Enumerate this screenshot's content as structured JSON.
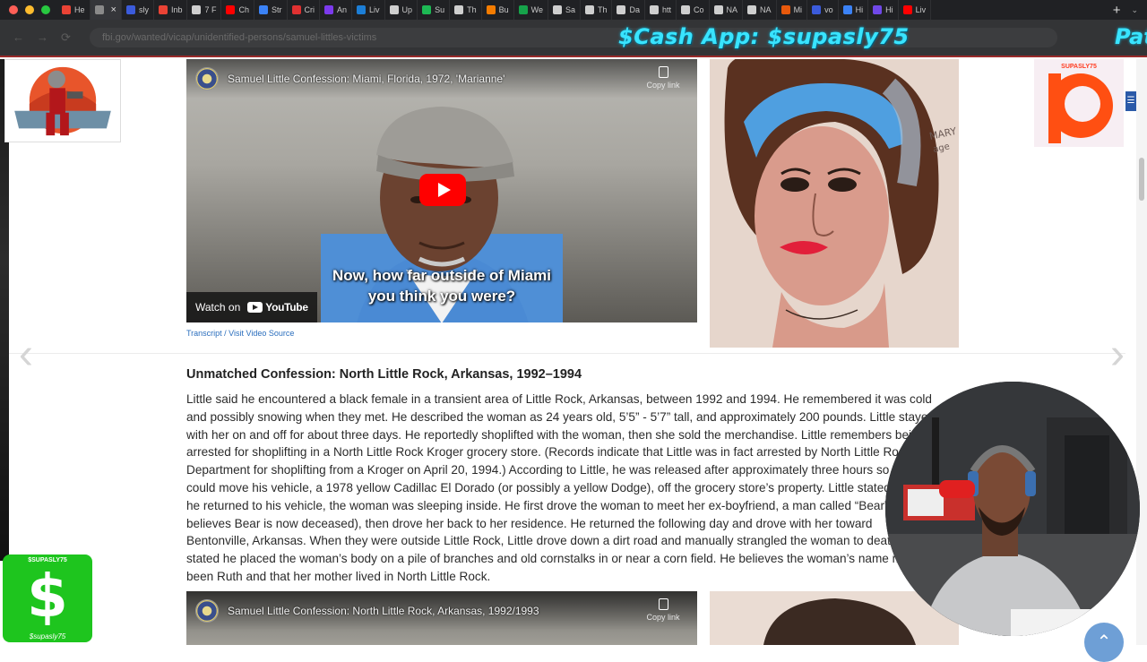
{
  "browser": {
    "tabs": [
      {
        "label": "He",
        "icon": "gmail-icon",
        "color": "#ea4335"
      },
      {
        "label": "",
        "icon": "globe-icon",
        "color": "#8a8a8a",
        "active": true
      },
      {
        "label": "sly",
        "icon": "shield-icon",
        "color": "#3b5bdb"
      },
      {
        "label": "Inb",
        "icon": "gmail-icon",
        "color": "#ea4335"
      },
      {
        "label": "7 F",
        "icon": "glasses-icon",
        "color": "#cfcfcf"
      },
      {
        "label": "Ch",
        "icon": "youtube-icon",
        "color": "#ff0000"
      },
      {
        "label": "Str",
        "icon": "star-icon",
        "color": "#3b82f6"
      },
      {
        "label": "Cri",
        "icon": "record-icon",
        "color": "#e03131"
      },
      {
        "label": "An",
        "icon": "app-icon",
        "color": "#7c3aed"
      },
      {
        "label": "Liv",
        "icon": "k-icon",
        "color": "#1c7ed6"
      },
      {
        "label": "Up",
        "icon": "upload-icon",
        "color": "#cfcfcf"
      },
      {
        "label": "Su",
        "icon": "spotify-icon",
        "color": "#1db954"
      },
      {
        "label": "Th",
        "icon": "doc-icon",
        "color": "#cfcfcf"
      },
      {
        "label": "Bu",
        "icon": "blogger-icon",
        "color": "#f57c00"
      },
      {
        "label": "We",
        "icon": "x-icon",
        "color": "#16a34a"
      },
      {
        "label": "Sa",
        "icon": "apple-icon",
        "color": "#cfcfcf"
      },
      {
        "label": "Th",
        "icon": "square-icon",
        "color": "#cfcfcf"
      },
      {
        "label": "Da",
        "icon": "link-icon",
        "color": "#cfcfcf"
      },
      {
        "label": "htt",
        "icon": "mask-icon",
        "color": "#cfcfcf"
      },
      {
        "label": "Co",
        "icon": "c-icon",
        "color": "#cfcfcf"
      },
      {
        "label": "NA",
        "icon": "c-icon",
        "color": "#cfcfcf"
      },
      {
        "label": "NA",
        "icon": "c-icon",
        "color": "#cfcfcf"
      },
      {
        "label": "Mi",
        "icon": "image-icon",
        "color": "#e8590c"
      },
      {
        "label": "vo",
        "icon": "shield-icon",
        "color": "#3b5bdb"
      },
      {
        "label": "Hi",
        "icon": "history-icon",
        "color": "#3b82f6"
      },
      {
        "label": "Hi",
        "icon": "grid-icon",
        "color": "#7048e8"
      },
      {
        "label": "Liv",
        "icon": "youtube-icon",
        "color": "#ff0000"
      }
    ],
    "new_tab": "+",
    "tab_menu": "⌄",
    "url": "fbi.gov/wanted/vicap/unidentified-persons/samuel-littles-victims",
    "nav": {
      "back": "←",
      "forward": "→",
      "reload": "⟳"
    }
  },
  "overlay": {
    "cash_banner": "$Cash App: $supasly75",
    "cash_banner_right": "Pat",
    "patreon_handle": "SUPASLY75",
    "cashapp_handle": "$SUPASLY75",
    "cashapp_symbol": "$",
    "cashapp_signature": "$supasly75",
    "scroll_top": "⌃"
  },
  "page": {
    "arrow_left": "‹",
    "arrow_right": "›",
    "side_tab": "☰",
    "video_top": {
      "title": "Samuel Little Confession: Miami, Florida, 1972, 'Marianne'",
      "copy_label": "Copy link",
      "caption_line1": "Now, how far outside of Miami",
      "caption_line2": "you think you were?",
      "watch_on": "Watch on",
      "youtube": "YouTube"
    },
    "video_source": "Transcript / Visit Video Source",
    "portrait_top_text": "MARY",
    "portrait_top_text2": "age",
    "article": {
      "title": "Unmatched Confession: North Little Rock, Arkansas, 1992–1994",
      "lines": [
        "Little said he encountered a black female in a transient area of Little Rock, Arkansas, between 1992 and 1994. He remembered it was cold",
        "and possibly snowing when they met. He described the woman as 24 years old, 5’5” - 5’7” tall, and approximately 200 pounds. Little stayed",
        "with her on and off for about three days. He reportedly shoplifted with the woman, then she sold the merchandise. Little remembers being",
        "arrested for shoplifting in a North Little Rock Kroger grocery store. (Records indicate that Little was in fact arrested by North Little Rock Police",
        "Department for shoplifting from a Kroger on April 20, 1994.) According to Little, he was released after approximately three hours so he",
        "could move his vehicle, a 1978 yellow Cadillac El Dorado (or possibly a yellow Dodge), off the grocery store’s property. Little stated when",
        "he returned to his vehicle, the woman was sleeping inside. He first drove the woman to meet her ex-boyfriend, a man called “Bear” (Little",
        "believes Bear is now deceased), then drove her back to her residence. He returned the following day and drove with her toward",
        "Bentonville, Arkansas. When they were outside Little Rock, Little drove down a dirt road and manually strangled the woman to death. Little",
        "stated he placed the woman’s body on a pile of branches and old cornstalks in or near a corn field. He believes the woman’s name may have",
        "been Ruth and that her mother lived in North Little Rock."
      ]
    },
    "video_bottom": {
      "title": "Samuel Little Confession: North Little Rock, Arkansas, 1992/1993",
      "copy_label": "Copy link"
    }
  }
}
